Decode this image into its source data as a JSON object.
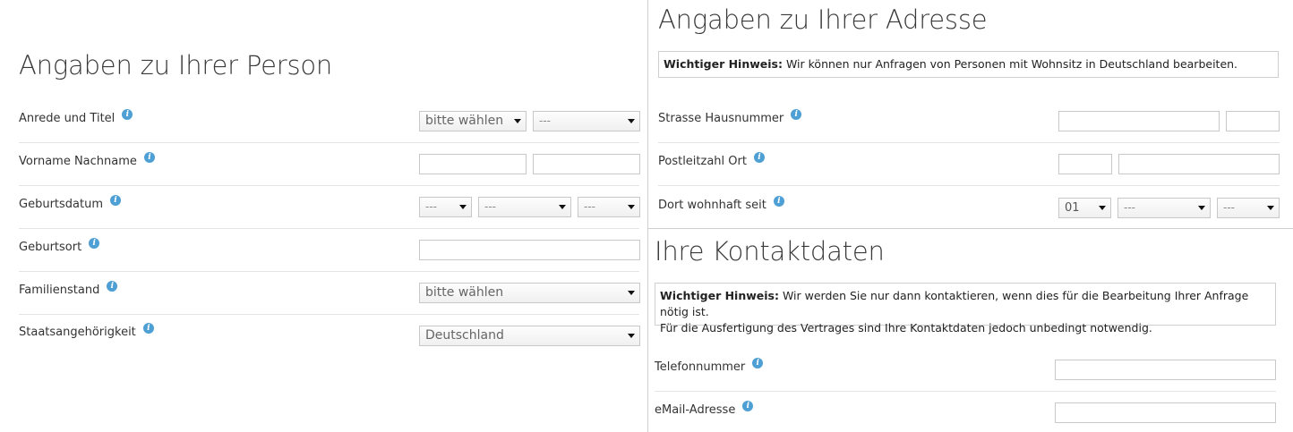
{
  "person": {
    "title": "Angaben zu Ihrer Person",
    "rows": [
      {
        "label": "Anrede und Titel"
      },
      {
        "label": "Vorname Nachname"
      },
      {
        "label": "Geburtsdatum"
      },
      {
        "label": "Geburtsort"
      },
      {
        "label": "Familienstand"
      },
      {
        "label": "Staatsangehörigkeit"
      }
    ],
    "anrede_select": "bitte wählen",
    "titel_select": "---",
    "geburtstag_select": "---",
    "geburtsmonat_select": "---",
    "geburtsjahr_select": "---",
    "familienstand_select": "bitte wählen",
    "staatsangehoerigkeit_select": "Deutschland"
  },
  "address": {
    "title": "Angaben zu Ihrer Adresse",
    "notice_bold": "Wichtiger Hinweis:",
    "notice_text": " Wir können nur Anfragen von Personen mit Wohnsitz in Deutschland bearbeiten.",
    "rows": [
      {
        "label": "Strasse Hausnummer"
      },
      {
        "label": "Postleitzahl Ort"
      },
      {
        "label": "Dort wohnhaft seit"
      }
    ],
    "seit_tag_select": "01",
    "seit_monat_select": "---",
    "seit_jahr_select": "---"
  },
  "contact": {
    "title": "Ihre Kontaktdaten",
    "notice_bold": "Wichtiger Hinweis:",
    "notice_text": " Wir werden Sie nur dann kontaktieren, wenn dies für die Bearbeitung Ihrer Anfrage nötig ist.",
    "notice_line2": "Für die Ausfertigung des Vertrages sind Ihre Kontaktdaten jedoch unbedingt notwendig.",
    "rows": [
      {
        "label": "Telefonnummer"
      },
      {
        "label": "eMail-Adresse"
      }
    ]
  },
  "icons": {
    "info": "info-icon",
    "info_glyph": "i"
  },
  "colors": {
    "info_icon": "#4e9fd4",
    "border": "#c8c8c8",
    "divider": "#cfcfcf"
  }
}
